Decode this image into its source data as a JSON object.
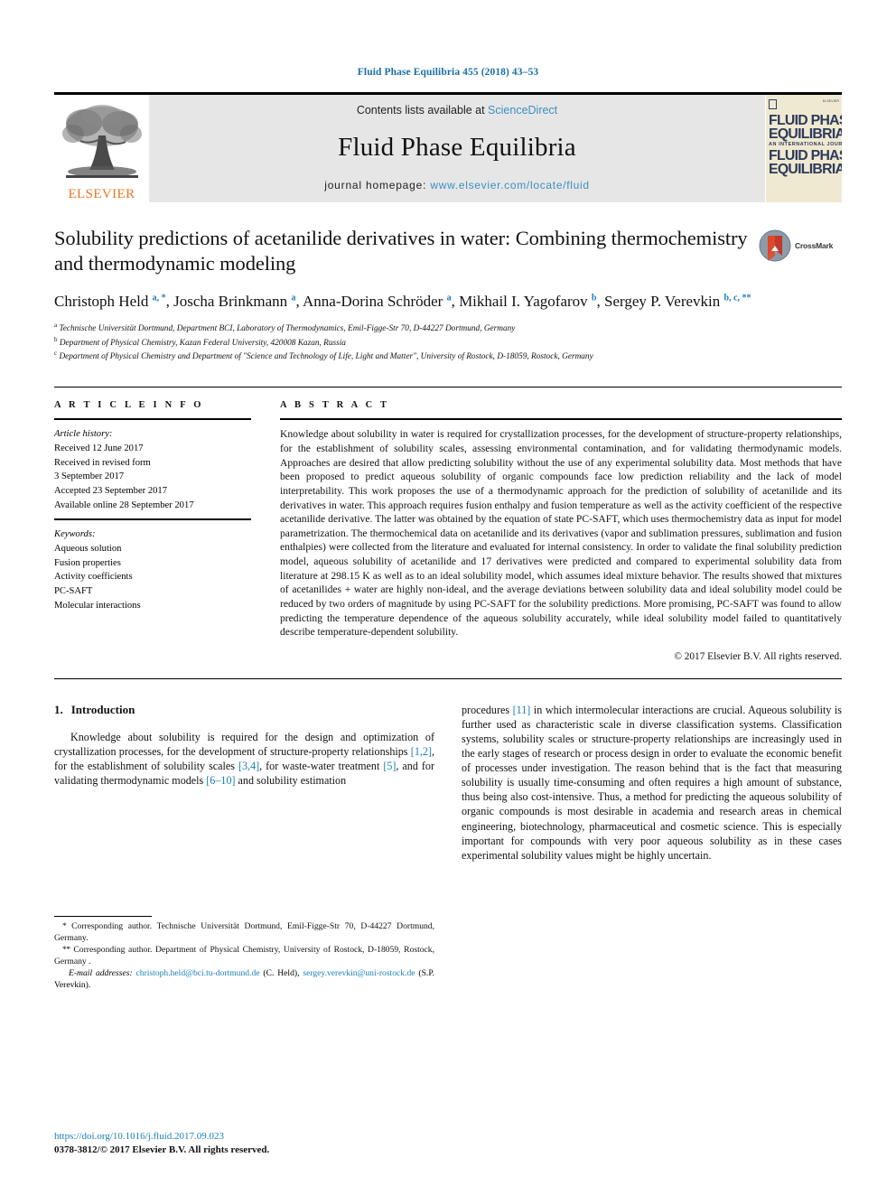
{
  "running_head": "Fluid Phase Equilibria 455 (2018) 43–53",
  "masthead": {
    "publisher_name": "ELSEVIER",
    "contents_prefix": "Contents lists available at ",
    "sciencedirect": "ScienceDirect",
    "journal_title": "Fluid Phase Equilibria",
    "homepage_prefix": "journal homepage: ",
    "homepage_url": "www.elsevier.com/locate/fluid",
    "cover": {
      "line1": "FLUID PHASE",
      "line2": "EQUILIBRIA",
      "subtitle": "AN INTERNATIONAL JOURNAL",
      "line3": "FLUID PHASE",
      "line4": "EQUILIBRIA",
      "corner_label": "ELSEVIER"
    },
    "accent_link_color": "#3a8fc4",
    "banner_bg": "#e6e6e6",
    "elsevier_orange": "#E87722"
  },
  "title": "Solubility predictions of acetanilide derivatives in water: Combining thermochemistry and thermodynamic modeling",
  "crossmark_label": "CrossMark",
  "authors": [
    {
      "name": "Christoph Held",
      "marks": "a, *"
    },
    {
      "name": "Joscha Brinkmann",
      "marks": "a"
    },
    {
      "name": "Anna-Dorina Schröder",
      "marks": "a"
    },
    {
      "name": "Mikhail I. Yagofarov",
      "marks": "b"
    },
    {
      "name": "Sergey P. Verevkin",
      "marks": "b, c, **"
    }
  ],
  "affiliations": [
    {
      "mark": "a",
      "text": "Technische Universität Dortmund, Department BCI, Laboratory of Thermodynamics, Emil-Figge-Str 70, D-44227 Dortmund, Germany"
    },
    {
      "mark": "b",
      "text": "Department of Physical Chemistry, Kazan Federal University, 420008 Kazan, Russia"
    },
    {
      "mark": "c",
      "text": "Department of Physical Chemistry and Department of \"Science and Technology of Life, Light and Matter\", University of Rostock, D-18059, Rostock, Germany"
    }
  ],
  "article_info": {
    "heading": "A R T I C L E  I N F O",
    "history_label": "Article history:",
    "history": [
      "Received 12 June 2017",
      "Received in revised form",
      "3 September 2017",
      "Accepted 23 September 2017",
      "Available online 28 September 2017"
    ],
    "keywords_label": "Keywords:",
    "keywords": [
      "Aqueous solution",
      "Fusion properties",
      "Activity coefficients",
      "PC-SAFT",
      "Molecular interactions"
    ]
  },
  "abstract": {
    "heading": "A B S T R A C T",
    "text": "Knowledge about solubility in water is required for crystallization processes, for the development of structure-property relationships, for the establishment of solubility scales, assessing environmental contamination, and for validating thermodynamic models. Approaches are desired that allow predicting solubility without the use of any experimental solubility data. Most methods that have been proposed to predict aqueous solubility of organic compounds face low prediction reliability and the lack of model interpretability. This work proposes the use of a thermodynamic approach for the prediction of solubility of acetanilide and its derivatives in water. This approach requires fusion enthalpy and fusion temperature as well as the activity coefficient of the respective acetanilide derivative. The latter was obtained by the equation of state PC-SAFT, which uses thermochemistry data as input for model parametrization. The thermochemical data on acetanilide and its derivatives (vapor and sublimation pressures, sublimation and fusion enthalpies) were collected from the literature and evaluated for internal consistency. In order to validate the final solubility prediction model, aqueous solubility of acetanilide and 17 derivatives were predicted and compared to experimental solubility data from literature at 298.15 K as well as to an ideal solubility model, which assumes ideal mixture behavior. The results showed that mixtures of acetanilides + water are highly non-ideal, and the average deviations between solubility data and ideal solubility model could be reduced by two orders of magnitude by using PC-SAFT for the solubility predictions. More promising, PC-SAFT was found to allow predicting the temperature dependence of the aqueous solubility accurately, while ideal solubility model failed to quantitatively describe temperature-dependent solubility.",
    "copyright": "© 2017 Elsevier B.V. All rights reserved."
  },
  "introduction": {
    "number": "1.",
    "heading": "Introduction",
    "left_paragraph_parts": [
      "Knowledge about solubility is required for the design and optimization of crystallization processes, for the development of structure-property relationships ",
      "[1,2]",
      ", for the establishment of solubility scales ",
      "[3,4]",
      ", for waste-water treatment ",
      "[5]",
      ", and for validating thermodynamic models ",
      "[6–10]",
      " and solubility estimation"
    ],
    "right_paragraph_parts": [
      "procedures ",
      "[11]",
      " in which intermolecular interactions are crucial. Aqueous solubility is further used as characteristic scale in diverse classification systems. Classification systems, solubility scales or structure-property relationships are increasingly used in the early stages of research or process design in order to evaluate the economic benefit of processes under investigation. The reason behind that is the fact that measuring solubility is usually time-consuming and often requires a high amount of substance, thus being also cost-intensive. Thus, a method for predicting the aqueous solubility of organic compounds is most desirable in academia and research areas in chemical engineering, biotechnology, pharmaceutical and cosmetic science. This is especially important for compounds with very poor aqueous solubility as in these cases experimental solubility values might be highly uncertain."
    ]
  },
  "footnotes": {
    "corresponding_1_mark": "*",
    "corresponding_1": "Corresponding author. Technische Universität Dortmund, Emil-Figge-Str 70, D-44227 Dortmund, Germany.",
    "corresponding_2_mark": "**",
    "corresponding_2": "Corresponding author. Department of Physical Chemistry, University of Rostock, D-18059, Rostock, Germany .",
    "email_label": "E-mail addresses:",
    "email_1": "christoph.held@bci.tu-dortmund.de",
    "email_1_owner": "(C. Held)",
    "email_2": "sergey.verevkin@uni-rostock.de",
    "email_2_owner": "(S.P. Verevkin)."
  },
  "page_footer": {
    "doi": "https://doi.org/10.1016/j.fluid.2017.09.023",
    "issn_line": "0378-3812/© 2017 Elsevier B.V. All rights reserved."
  }
}
